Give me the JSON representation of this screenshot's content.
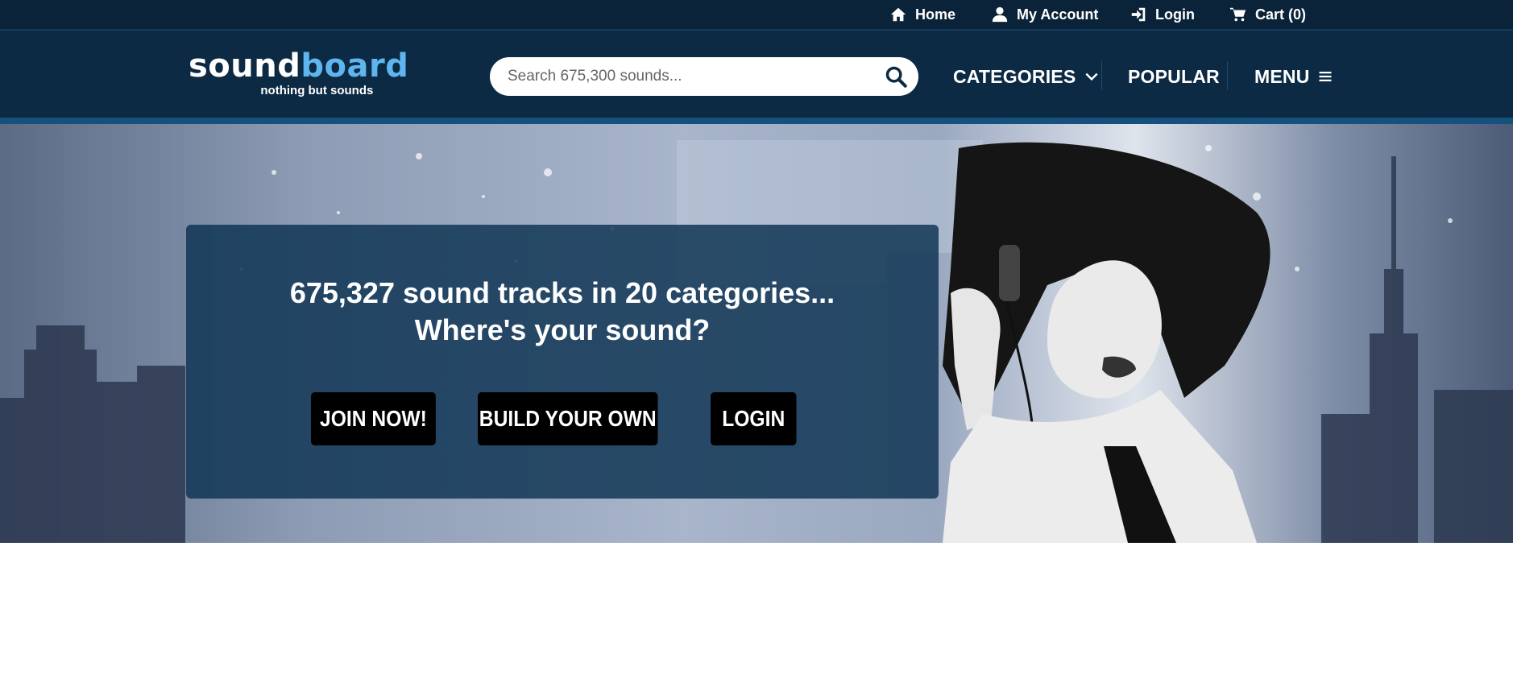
{
  "topbar": {
    "home": "Home",
    "account": "My Account",
    "login": "Login",
    "cart": "Cart (0)"
  },
  "logo": {
    "part1": "sound",
    "part2": "board",
    "tagline": "nothing but sounds"
  },
  "search": {
    "placeholder": "Search 675,300 sounds..."
  },
  "nav": {
    "categories": "CATEGORIES",
    "popular": "POPULAR",
    "menu": "MENU"
  },
  "hero": {
    "headline_line1": "675,327 sound tracks in 20 categories...",
    "headline_line2": "Where's your sound?",
    "buttons": {
      "join": "JOIN NOW!",
      "build": "BUILD YOUR OWN",
      "login": "LOGIN"
    }
  },
  "colors": {
    "topbar": "#0a2338",
    "header": "#0c2a44",
    "accent": "#5fb6ef",
    "overlay": "#0e3454",
    "button": "#000000"
  }
}
